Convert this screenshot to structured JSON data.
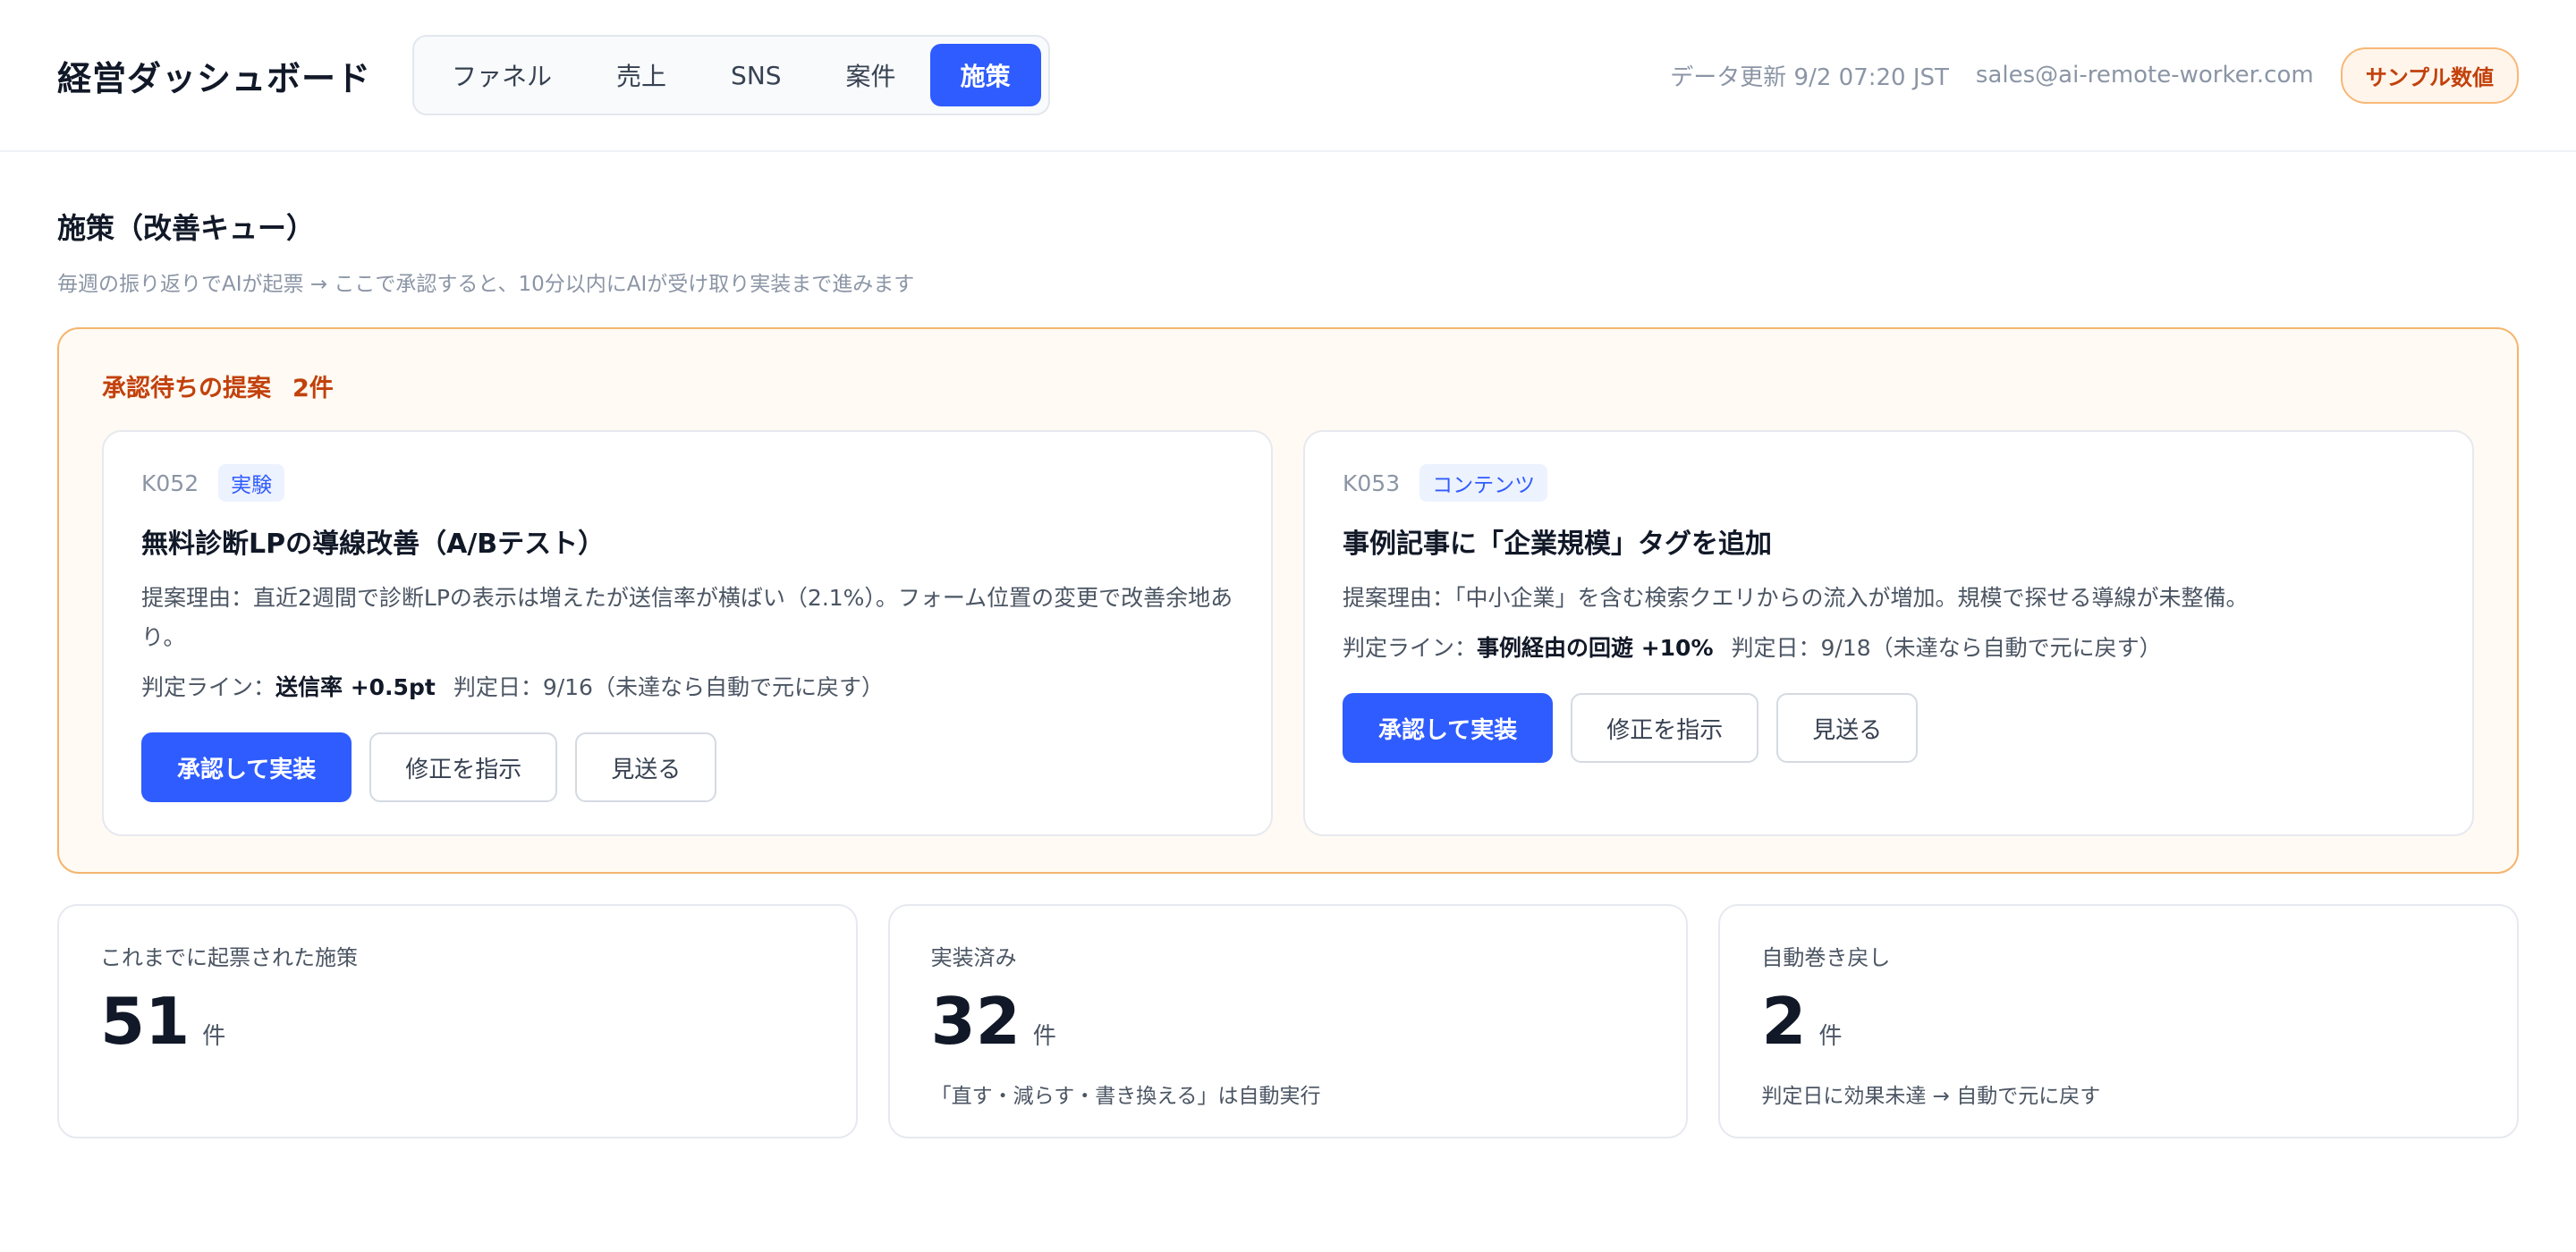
{
  "header": {
    "title": "経営ダッシュボード",
    "tabs": [
      {
        "label": "ファネル",
        "active": false
      },
      {
        "label": "売上",
        "active": false
      },
      {
        "label": "SNS",
        "active": false
      },
      {
        "label": "案件",
        "active": false
      },
      {
        "label": "施策",
        "active": true
      }
    ],
    "updated": "データ更新 9/2 07:20 JST",
    "email": "sales@ai-remote-worker.com",
    "badge": "サンプル数値"
  },
  "section": {
    "title": "施策（改善キュー）",
    "subtitle": "毎週の振り返りでAIが起票 → ここで承認すると、10分以内にAIが受け取り実装まで進みます"
  },
  "pending": {
    "label": "承認待ちの提案",
    "count": "2件",
    "cards": [
      {
        "id": "K052",
        "tag": "実験",
        "title": "無料診断LPの導線改善（A/Bテスト）",
        "reason": "提案理由：直近2週間で診断LPの表示は増えたが送信率が横ばい（2.1%）。フォーム位置の変更で改善余地あり。",
        "criteria_label": "判定ライン：",
        "criteria_value": "送信率 +0.5pt",
        "decision": "判定日：9/16（未達なら自動で元に戻す）",
        "approve": "承認して実装",
        "revise": "修正を指示",
        "skip": "見送る"
      },
      {
        "id": "K053",
        "tag": "コンテンツ",
        "title": "事例記事に「企業規模」タグを追加",
        "reason": "提案理由：「中小企業」を含む検索クエリからの流入が増加。規模で探せる導線が未整備。",
        "criteria_label": "判定ライン：",
        "criteria_value": "事例経由の回遊 +10%",
        "decision": "判定日：9/18（未達なら自動で元に戻す）",
        "approve": "承認して実装",
        "revise": "修正を指示",
        "skip": "見送る"
      }
    ]
  },
  "stats": [
    {
      "label": "これまでに起票された施策",
      "value": "51",
      "unit": "件",
      "note": ""
    },
    {
      "label": "実装済み",
      "value": "32",
      "unit": "件",
      "note": "「直す・減らす・書き換える」は自動実行"
    },
    {
      "label": "自動巻き戻し",
      "value": "2",
      "unit": "件",
      "note": "判定日に効果未達 → 自動で元に戻す"
    }
  ],
  "colors": {
    "accent": "#2f5cff",
    "warning": "#c2410c",
    "warning_border": "#f4b56e",
    "warning_bg": "#fffaf3"
  }
}
